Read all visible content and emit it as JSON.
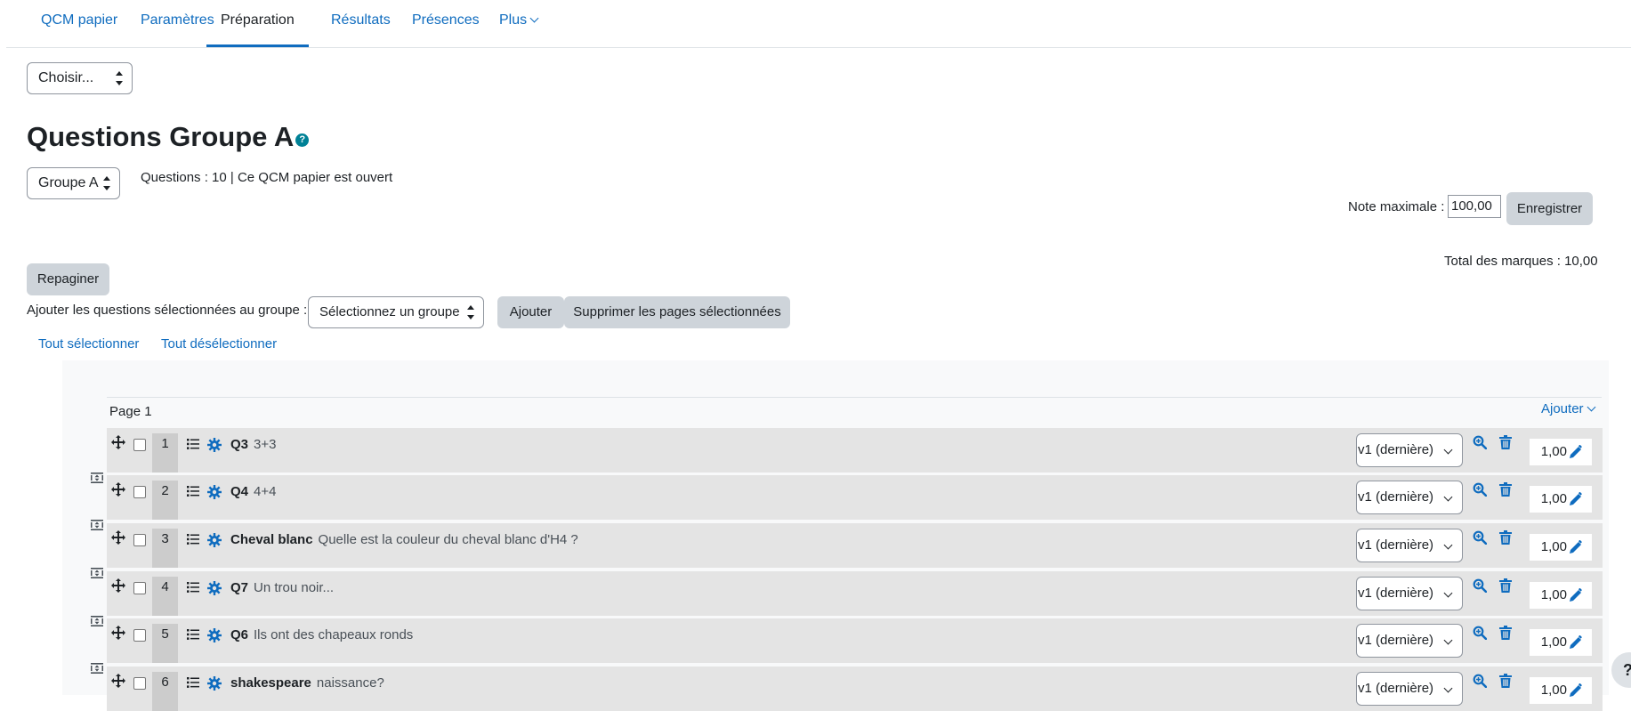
{
  "nav": {
    "tabs": [
      {
        "label": "QCM papier"
      },
      {
        "label": "Paramètres"
      },
      {
        "label": "Préparation"
      },
      {
        "label": "Résultats"
      },
      {
        "label": "Présences"
      },
      {
        "label": "Plus"
      }
    ],
    "active_tab": "Préparation"
  },
  "jump_select": {
    "value": "Choisir..."
  },
  "heading": {
    "title": "Questions Groupe A",
    "help_icon": "question-circle-icon"
  },
  "group_select": {
    "value": "Groupe A"
  },
  "info": {
    "text": "Questions : 10 | Ce QCM papier est ouvert"
  },
  "maxgrade": {
    "label": "Note maximale :",
    "value": "100,00",
    "save_label": "Enregistrer"
  },
  "total": {
    "text": "Total des marques : 10,00"
  },
  "repaginate_label": "Repaginer",
  "add_to_group": {
    "label": "Ajouter les questions sélectionnées au groupe :",
    "select_value": "Sélectionnez un groupe",
    "add_label": "Ajouter",
    "delete_pages_label": "Supprimer les pages sélectionnées"
  },
  "selection": {
    "select_all": "Tout sélectionner",
    "deselect_all": "Tout désélectionner"
  },
  "page": {
    "title": "Page 1",
    "add_label": "Ajouter"
  },
  "questions": [
    {
      "number": "1",
      "name": "Q3",
      "text": "3+3",
      "version": "v1 (dernière)",
      "mark": "1,00"
    },
    {
      "number": "2",
      "name": "Q4",
      "text": "4+4",
      "version": "v1 (dernière)",
      "mark": "1,00"
    },
    {
      "number": "3",
      "name": "Cheval blanc",
      "text": "Quelle est la couleur du cheval blanc d'H4 ?",
      "version": "v1 (dernière)",
      "mark": "1,00"
    },
    {
      "number": "4",
      "name": "Q7",
      "text": "Un trou noir...",
      "version": "v1 (dernière)",
      "mark": "1,00"
    },
    {
      "number": "5",
      "name": "Q6",
      "text": "Ils ont des chapeaux ronds",
      "version": "v1 (dernière)",
      "mark": "1,00"
    },
    {
      "number": "6",
      "name": "shakespeare",
      "text": "naissance?",
      "version": "v1 (dernière)",
      "mark": "1,00"
    }
  ],
  "help_fab": "?",
  "colors": {
    "link": "#0f6cbf",
    "button_bg": "#ced4da",
    "row_bg": "#e4e4e4",
    "help_teal": "#008196"
  }
}
